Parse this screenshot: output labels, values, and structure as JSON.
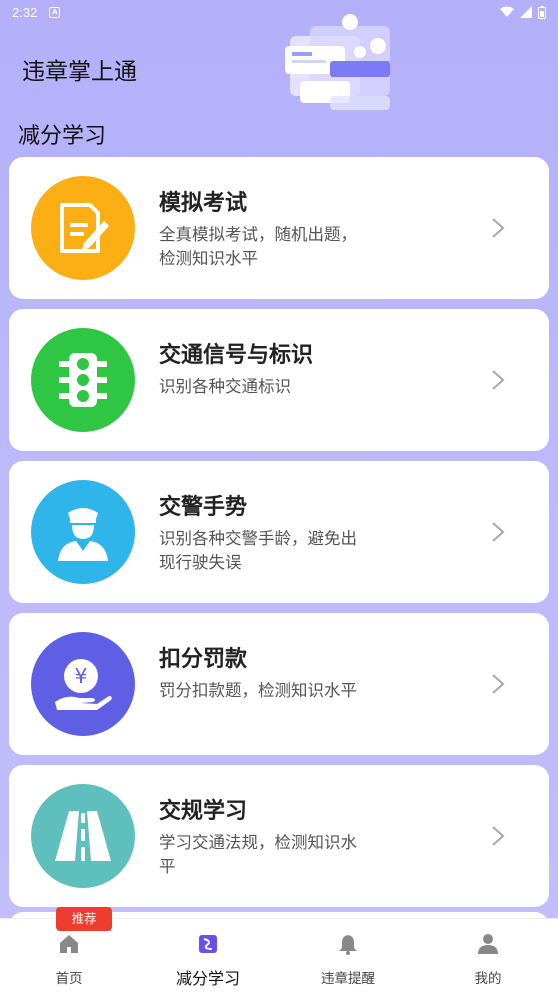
{
  "status_bar": {
    "time": "2:32",
    "notification_icon": "A"
  },
  "app_title": "违章掌上通",
  "section_title": "减分学习",
  "cards": [
    {
      "title": "模拟考试",
      "desc": "全真模拟考试，随机出题，检测知识水平",
      "icon": "exam-document-icon",
      "color": "#fcae15"
    },
    {
      "title": "交通信号与标识",
      "desc": "识别各种交通标识",
      "icon": "traffic-light-icon",
      "color": "#2ec643"
    },
    {
      "title": "交警手势",
      "desc": "识别各种交警手龄，避免出现行驶失误",
      "icon": "traffic-police-icon",
      "color": "#2fb5ea"
    },
    {
      "title": "扣分罚款",
      "desc": "罚分扣款题，检测知识水平",
      "icon": "yuan-hand-icon",
      "color": "#5f5fe6"
    },
    {
      "title": "交规学习",
      "desc": "学习交通法规，检测知识水平",
      "icon": "road-icon",
      "color": "#5fbfbd"
    }
  ],
  "bottom_nav": {
    "badge": "推荐",
    "items": [
      {
        "label": "首页",
        "icon": "home-icon"
      },
      {
        "label": "减分学习",
        "icon": "study-icon"
      },
      {
        "label": "违章提醒",
        "icon": "bell-icon"
      },
      {
        "label": "我的",
        "icon": "user-icon"
      }
    ]
  },
  "colors": {
    "background": "#b7b3fb",
    "accent": "#6a4ef0",
    "badge": "#f03c2e"
  }
}
